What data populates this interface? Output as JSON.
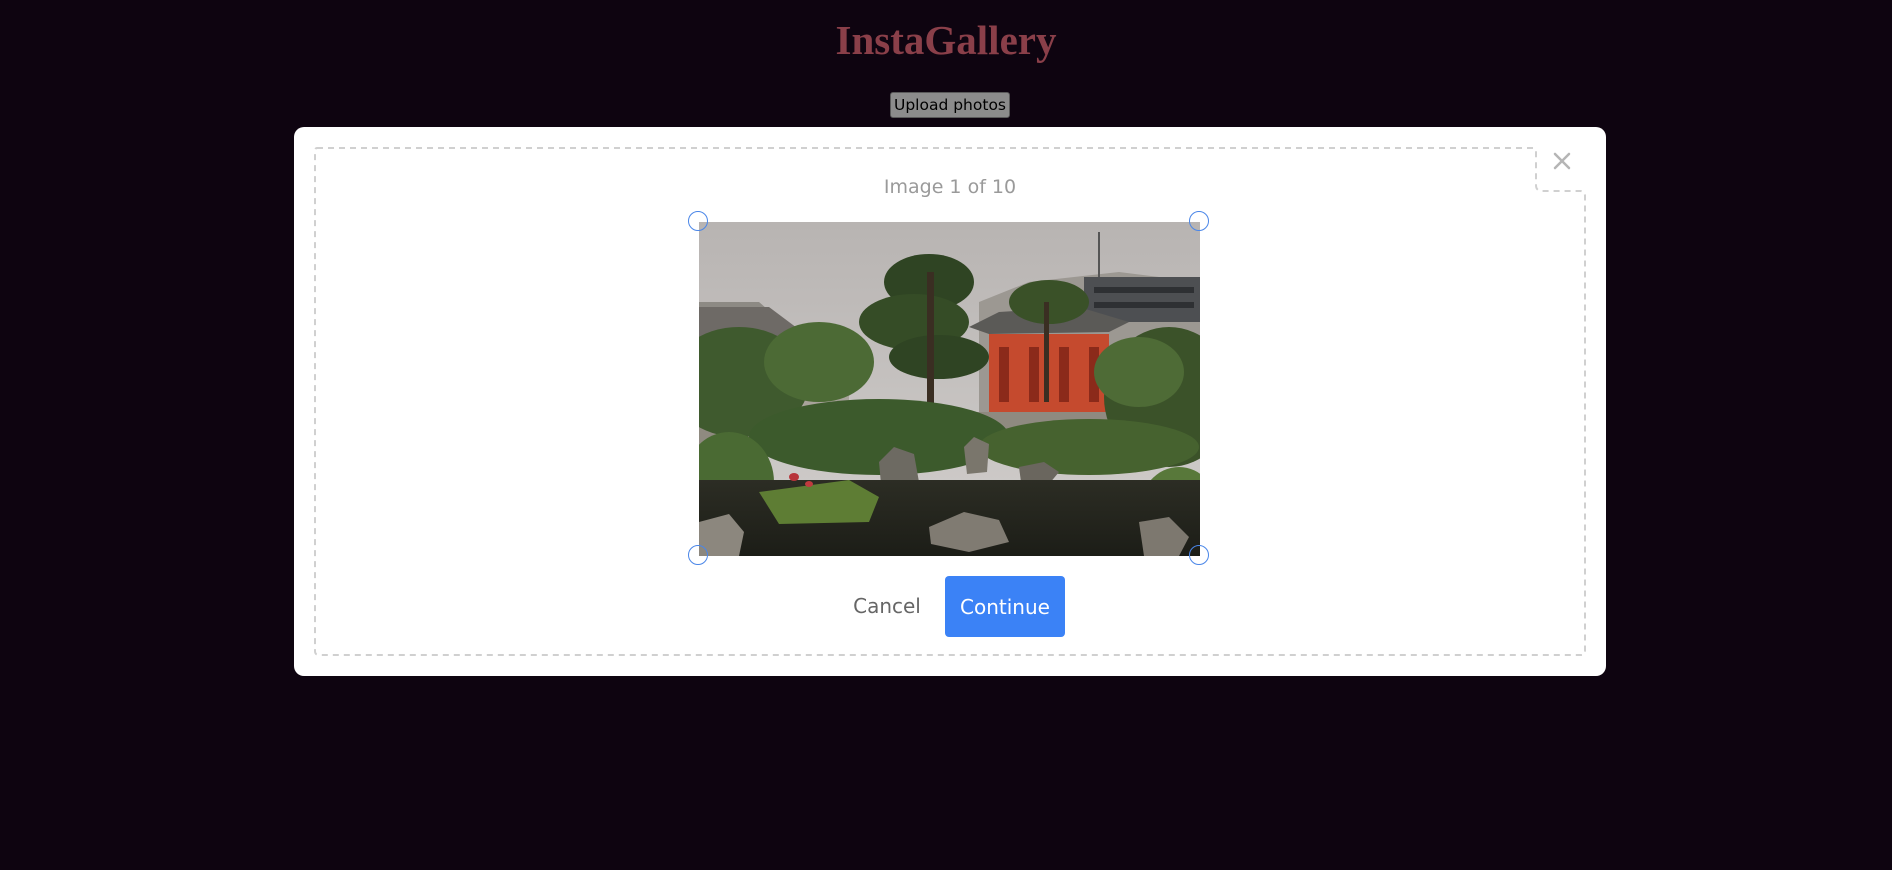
{
  "app": {
    "title": "InstaGallery"
  },
  "toolbar": {
    "upload_label": "Upload photos"
  },
  "modal": {
    "counter_text": "Image 1 of 10",
    "close_icon": "close-icon",
    "cancel_label": "Cancel",
    "continue_label": "Continue",
    "photo_subject": "japanese-temple-garden-photo"
  },
  "colors": {
    "background": "#0e0410",
    "title": "#8a3f49",
    "accent": "#3b82f6",
    "handle": "#4a86e8",
    "dropzone_border": "#d0d0d0"
  }
}
